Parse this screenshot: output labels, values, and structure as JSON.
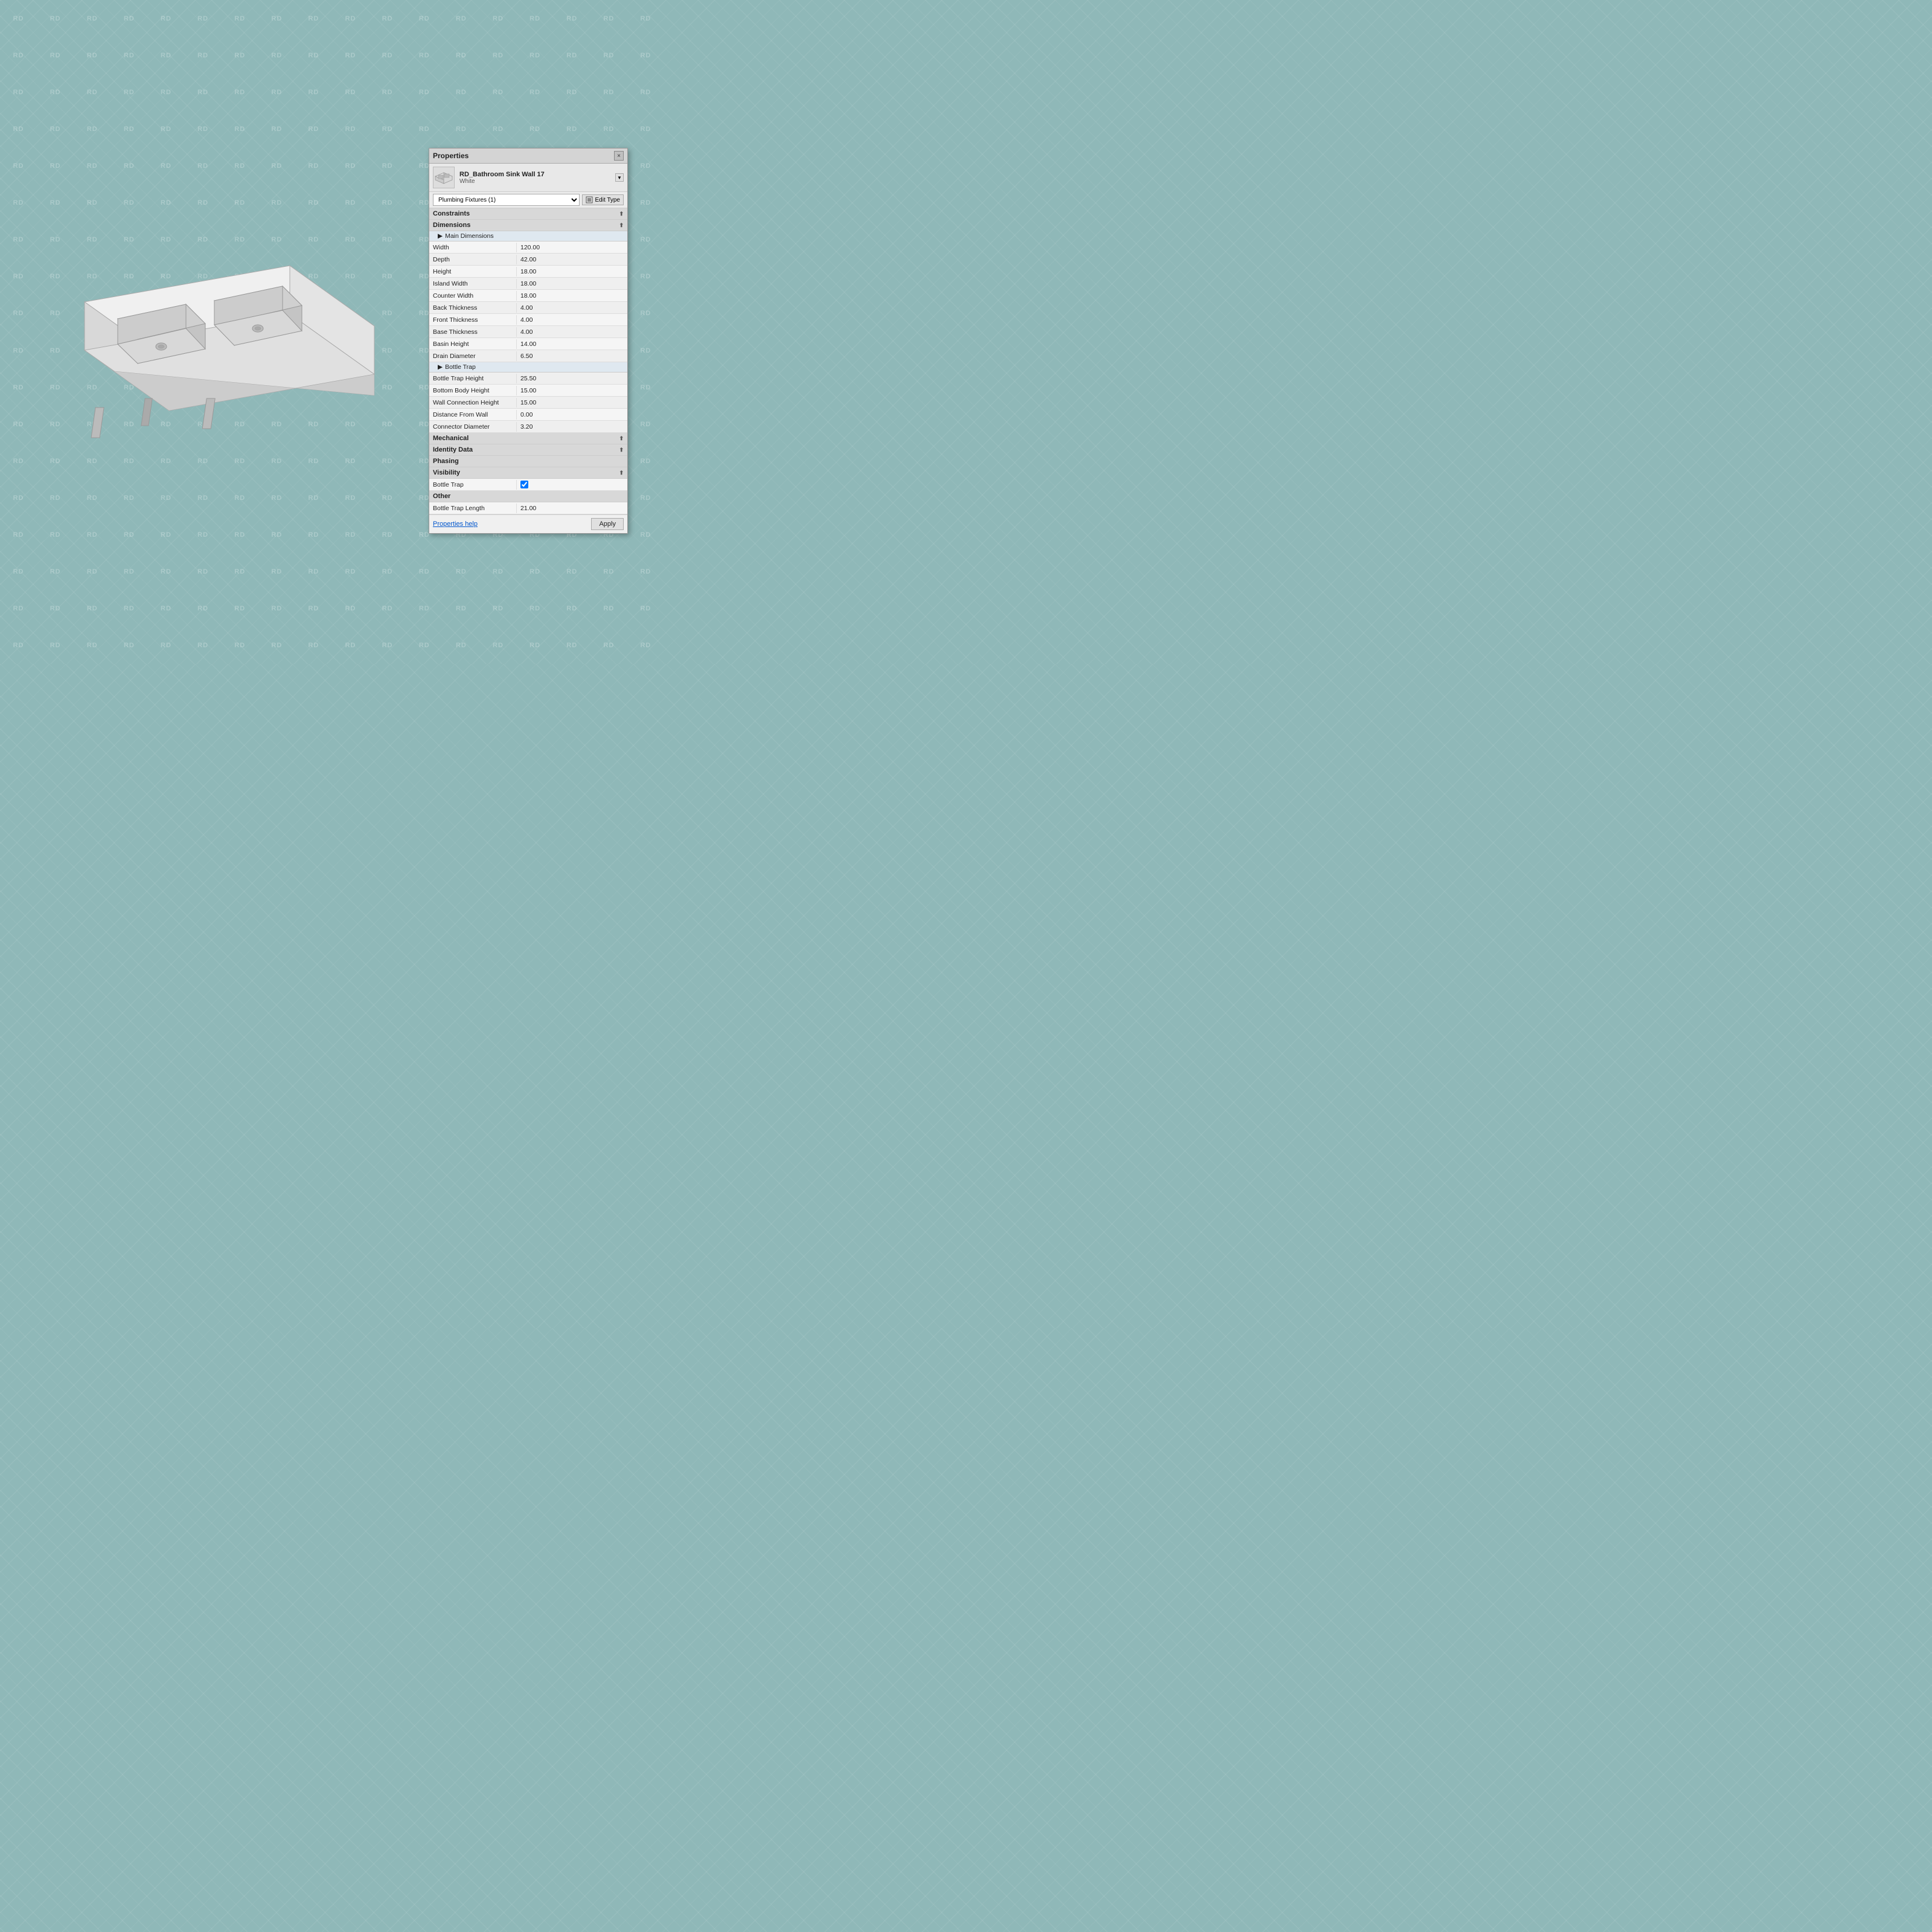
{
  "watermark": {
    "text": "RD",
    "count": 324
  },
  "panel": {
    "title": "Properties",
    "close_label": "×",
    "item_name": "RD_Bathroom Sink Wall 17",
    "item_sub": "White",
    "selector_label": "Plumbing Fixtures (1)",
    "edit_type_label": "Edit Type",
    "sections": {
      "constraints": "Constraints",
      "dimensions": "Dimensions",
      "main_dimensions": "Main Dimensions",
      "mechanical": "Mechanical",
      "identity_data": "Identity Data",
      "phasing": "Phasing",
      "visibility": "Visibility",
      "other": "Other"
    },
    "properties": [
      {
        "label": "Width",
        "value": "120.00"
      },
      {
        "label": "Depth",
        "value": "42.00"
      },
      {
        "label": "Height",
        "value": "18.00"
      },
      {
        "label": "Island Width",
        "value": "18.00"
      },
      {
        "label": "Counter Width",
        "value": "18.00"
      },
      {
        "label": "Back Thickness",
        "value": "4.00"
      },
      {
        "label": "Front Thickness",
        "value": "4.00"
      },
      {
        "label": "Base Thickness",
        "value": "4.00"
      },
      {
        "label": "Basin Height",
        "value": "14.00"
      },
      {
        "label": "Drain Diameter",
        "value": "6.50"
      },
      {
        "label": "Bottle Trap Height",
        "value": "25.50"
      },
      {
        "label": "Bottom Body Height",
        "value": "15.00"
      },
      {
        "label": "Wall Connection Height",
        "value": "15.00"
      },
      {
        "label": "Distance From Wall",
        "value": "0.00"
      },
      {
        "label": "Connector Diameter",
        "value": "3.20"
      }
    ],
    "bottle_trap_group_label": "Bottle Trap",
    "visibility_label": "Bottle Trap",
    "visibility_checked": true,
    "other_label": "Bottle Trap Length",
    "other_value": "21.00",
    "properties_help_label": "Properties help",
    "apply_label": "Apply"
  }
}
